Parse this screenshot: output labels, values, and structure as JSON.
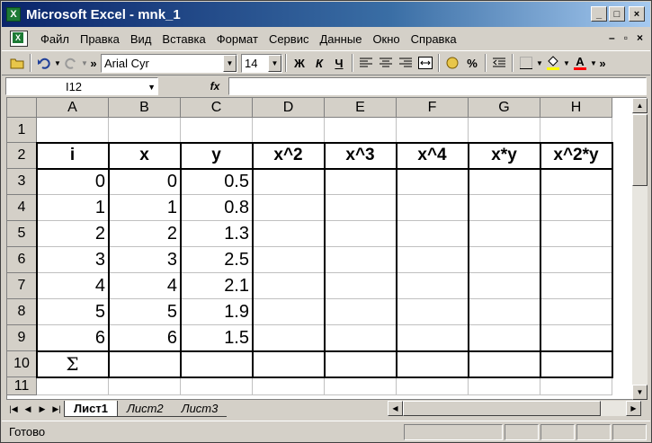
{
  "window": {
    "title": "Microsoft Excel - mnk_1",
    "app_icon": "excel-icon",
    "buttons": [
      "_",
      "□",
      "×"
    ]
  },
  "menubar": {
    "items": [
      "Файл",
      "Правка",
      "Вид",
      "Вставка",
      "Формат",
      "Сервис",
      "Данные",
      "Окно",
      "Справка"
    ],
    "doc_controls": [
      "–",
      "▫",
      "×"
    ]
  },
  "toolbar": {
    "font_name": "Arial Cyr",
    "font_size": "14",
    "bold": "Ж",
    "italic": "К",
    "underline": "Ч",
    "percent": "%",
    "overflow": "»",
    "font_color_label": "A"
  },
  "formula_bar": {
    "name_box": "I12",
    "fx": "fx",
    "value": ""
  },
  "columns": [
    "A",
    "B",
    "C",
    "D",
    "E",
    "F",
    "G",
    "H"
  ],
  "rows": [
    "1",
    "2",
    "3",
    "4",
    "5",
    "6",
    "7",
    "8",
    "9",
    "10",
    "11"
  ],
  "sheet": {
    "headers": [
      "i",
      "x",
      "y",
      "x^2",
      "x^3",
      "x^4",
      "x*y",
      "x^2*y"
    ],
    "data": [
      [
        "0",
        "0",
        "0.5"
      ],
      [
        "1",
        "1",
        "0.8"
      ],
      [
        "2",
        "2",
        "1.3"
      ],
      [
        "3",
        "3",
        "2.5"
      ],
      [
        "4",
        "4",
        "2.1"
      ],
      [
        "5",
        "5",
        "1.9"
      ],
      [
        "6",
        "6",
        "1.5"
      ]
    ],
    "sum_symbol": "Σ"
  },
  "tabs": {
    "sheets": [
      "Лист1",
      "Лист2",
      "Лист3"
    ],
    "active": "Лист1"
  },
  "status": {
    "text": "Готово"
  }
}
